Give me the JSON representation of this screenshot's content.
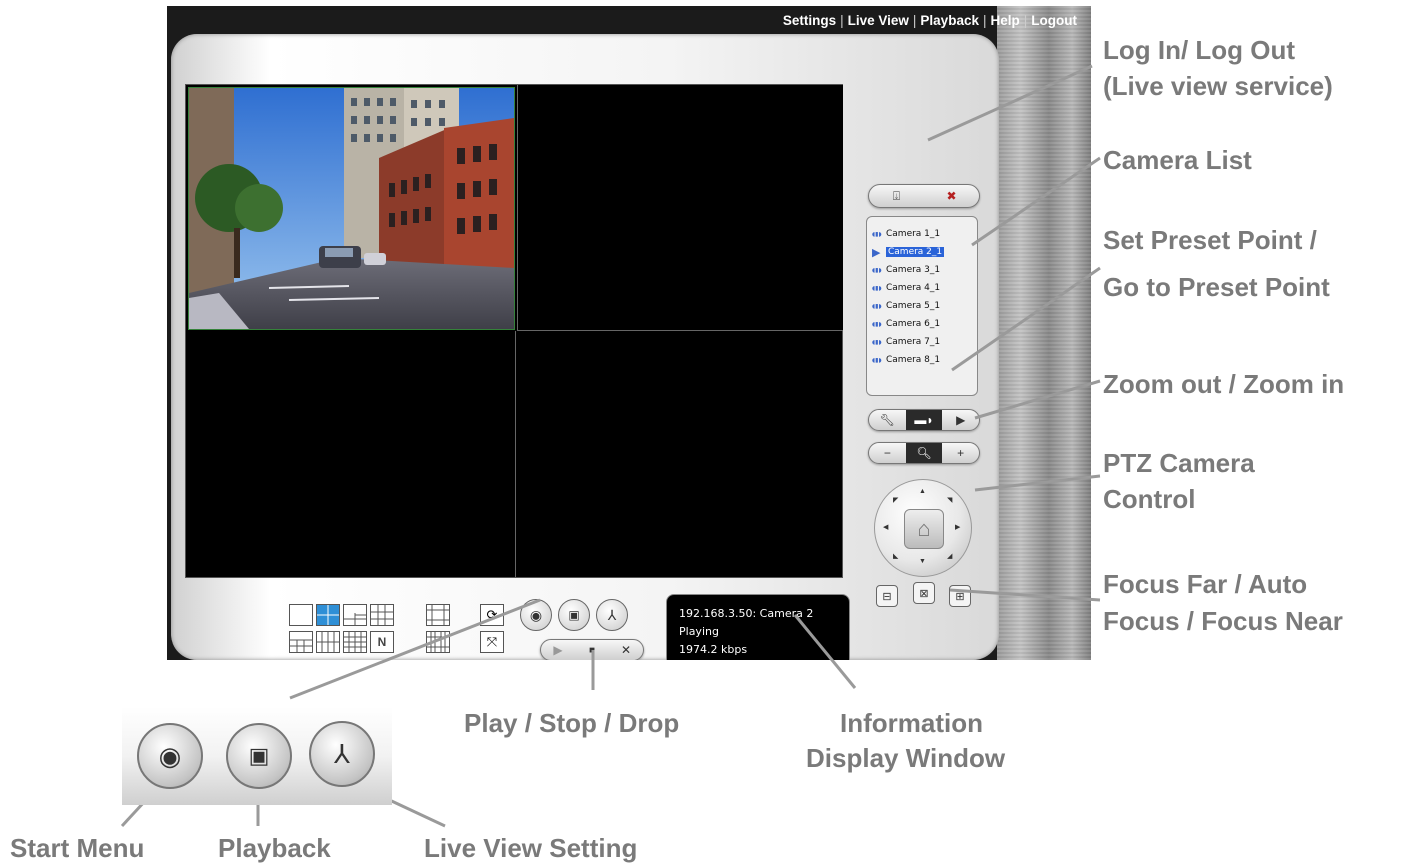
{
  "nav": [
    "Settings",
    "Live View",
    "Playback",
    "Help",
    "Logout"
  ],
  "cameras": [
    {
      "label": "Camera 1_1",
      "selected": false
    },
    {
      "label": "Camera 2_1",
      "selected": true
    },
    {
      "label": "Camera 3_1",
      "selected": false
    },
    {
      "label": "Camera 4_1",
      "selected": false
    },
    {
      "label": "Camera 5_1",
      "selected": false
    },
    {
      "label": "Camera 6_1",
      "selected": false
    },
    {
      "label": "Camera 7_1",
      "selected": false
    },
    {
      "label": "Camera 8_1",
      "selected": false
    }
  ],
  "info": {
    "line1": "192.168.3.50: Camera 2",
    "line2": "Playing",
    "line3": "1974.2 kbps"
  },
  "callouts": {
    "login": "Log In/ Log Out",
    "login2": "(Live view service)",
    "camera_list": "Camera List",
    "preset1": "Set Preset Point /",
    "preset2": "Go to Preset Point",
    "zoom": "Zoom out / Zoom in",
    "ptz1": "PTZ Camera",
    "ptz2": "Control",
    "focus1": "Focus Far / Auto",
    "focus2": "Focus / Focus Near",
    "play": "Play / Stop / Drop",
    "info1": "Information",
    "info2": "Display Window",
    "start": "Start Menu",
    "playback": "Playback",
    "liveview": "Live View Setting"
  },
  "icons": {
    "camera": "speaker-camera-icon",
    "selected": "play-triangle-icon"
  },
  "colors": {
    "label": "#7a7a7a",
    "selection": "#2a63d8",
    "layout_active": "#2e8fd6",
    "video_border": "#35823a"
  }
}
